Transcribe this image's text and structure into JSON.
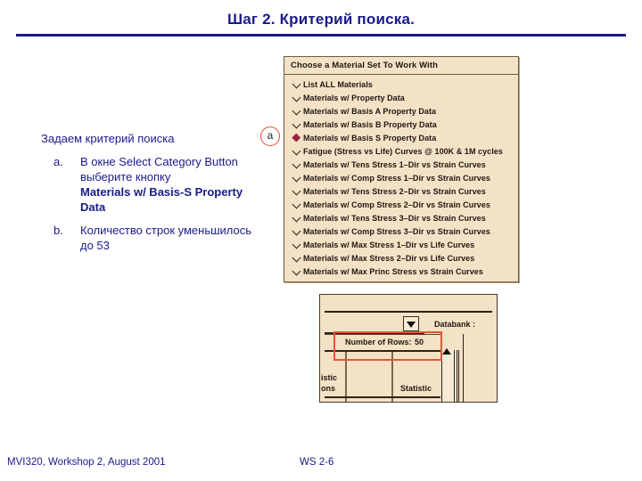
{
  "slide": {
    "title": "Шаг 2.  Критерий поиска.",
    "accent_color": "#1a1a8c",
    "highlight_color": "#e8543a",
    "panel_bg": "#f3e2c6"
  },
  "body": {
    "lead": "Задаем критерий поиска",
    "bullets": [
      {
        "marker": "a.",
        "text": "В окне Select Category Button выберите кнопку ",
        "emphasis": "Materials w/ Basis-S Property Data"
      },
      {
        "marker": "b.",
        "text": "Количество строк уменьшилось до 53",
        "emphasis": ""
      }
    ]
  },
  "callout": {
    "label": "a"
  },
  "material_panel": {
    "header": "Choose a Material Set To Work With",
    "items": [
      {
        "label": "List ALL Materials",
        "selected": false
      },
      {
        "label": "Materials w/ Property Data",
        "selected": false
      },
      {
        "label": "Materials w/ Basis A Property Data",
        "selected": false
      },
      {
        "label": "Materials w/ Basis B Property Data",
        "selected": false
      },
      {
        "label": "Materials w/ Basis S Property Data",
        "selected": true
      },
      {
        "label": "Fatigue (Stress vs Life) Curves @ 100K & 1M cycles",
        "selected": false
      },
      {
        "label": "Materials w/ Tens Stress 1–Dir vs Strain Curves",
        "selected": false
      },
      {
        "label": "Materials w/ Comp Stress 1–Dir vs Strain Curves",
        "selected": false
      },
      {
        "label": "Materials w/ Tens Stress 2–Dir vs Strain Curves",
        "selected": false
      },
      {
        "label": "Materials w/ Comp Stress 2–Dir vs Strain Curves",
        "selected": false
      },
      {
        "label": "Materials w/ Tens Stress 3–Dir vs Strain Curves",
        "selected": false
      },
      {
        "label": "Materials w/ Comp Stress 3–Dir vs Strain Curves",
        "selected": false
      },
      {
        "label": "Materials w/ Max Stress 1–Dir vs Life Curves",
        "selected": false
      },
      {
        "label": "Materials w/ Max Stress 2–Dir vs Life Curves",
        "selected": false
      },
      {
        "label": "Materials w/ Max Princ Stress vs Strain Curves",
        "selected": false
      }
    ]
  },
  "bottom_panel": {
    "databank_label": "Databank :",
    "rows_label": "Number of Rows:",
    "rows_value": "50",
    "stat_left_line1": "istic",
    "stat_left_line2": "ons",
    "stat_mid": "Statistic"
  },
  "footer": {
    "left": "MVI320, Workshop 2, August 2001",
    "right": "WS 2-6"
  }
}
